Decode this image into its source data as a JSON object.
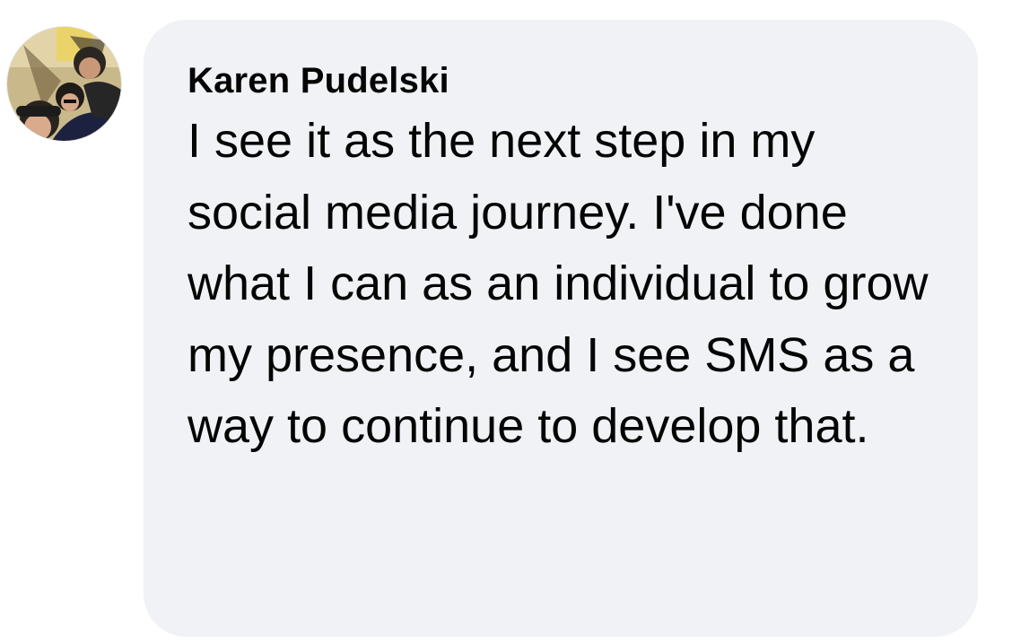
{
  "comment": {
    "author": "Karen Pudelski",
    "text": "I see it as the next step in my social media journey. I've done what I can as an individual to grow my presence, and I see SMS as a way to continue to develop that.",
    "avatar_icon": "profile-photo",
    "bubble_color": "#f0f2f5",
    "text_color": "#050505"
  }
}
